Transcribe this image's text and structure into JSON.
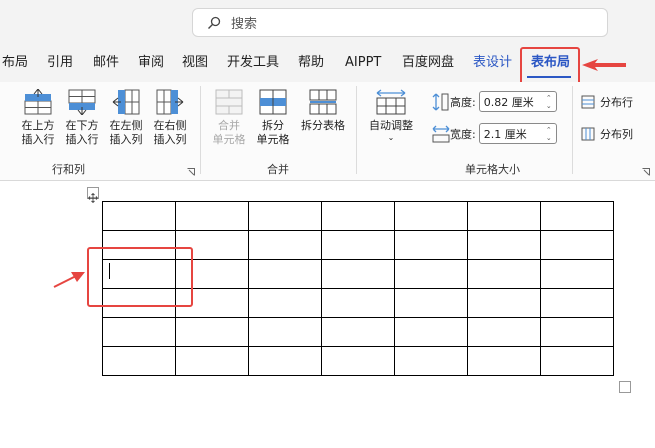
{
  "search": {
    "placeholder": "搜索"
  },
  "tabs": [
    "布局",
    "引用",
    "邮件",
    "审阅",
    "视图",
    "开发工具",
    "帮助",
    "AIPPT",
    "百度网盘",
    "表设计",
    "表布局"
  ],
  "ribbon": {
    "rows_cols": {
      "insert_above": [
        "在上方",
        "插入行"
      ],
      "insert_below": [
        "在下方",
        "插入行"
      ],
      "insert_left": [
        "在左侧",
        "插入列"
      ],
      "insert_right": [
        "在右侧",
        "插入列"
      ],
      "group_label": "行和列"
    },
    "merge": {
      "merge_cells": [
        "合并",
        "单元格"
      ],
      "split_cells": [
        "拆分",
        "单元格"
      ],
      "split_table": "拆分表格",
      "group_label": "合并"
    },
    "cell_size": {
      "autofit": "自动调整",
      "height_label": "高度:",
      "height_value": "0.82 厘米",
      "width_label": "宽度:",
      "width_value": "2.1 厘米",
      "distribute_rows": "分布行",
      "distribute_cols": "分布列",
      "group_label": "单元格大小"
    }
  },
  "table": {
    "rows": 6,
    "cols": 7
  },
  "colors": {
    "accent": "#2b57c4",
    "highlight": "#e64540"
  }
}
